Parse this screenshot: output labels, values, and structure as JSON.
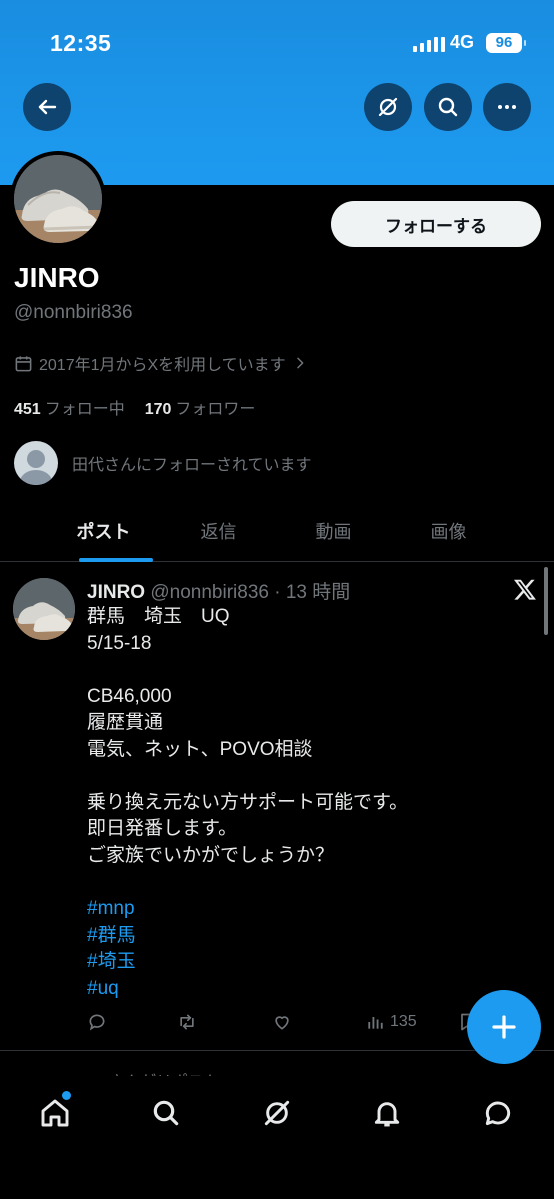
{
  "status_bar": {
    "time": "12:35",
    "network": "4G",
    "battery": "96"
  },
  "header": {
    "back_icon": "arrow-left-icon",
    "grok_icon": "grok-icon",
    "search_icon": "search-icon",
    "more_icon": "more-icon"
  },
  "profile": {
    "follow_label": "フォローする",
    "display_name": "JINRO",
    "handle": "@nonnbiri836",
    "joined": "2017年1月からXを利用しています",
    "following_count": "451",
    "following_label": "フォロー中",
    "followers_count": "170",
    "followers_label": "フォロワー",
    "followed_by": "田代さんにフォローされています"
  },
  "tabs": [
    {
      "label": "ポスト",
      "active": true
    },
    {
      "label": "返信",
      "active": false
    },
    {
      "label": "動画",
      "active": false
    },
    {
      "label": "画像",
      "active": false
    }
  ],
  "post": {
    "name": "JINRO",
    "meta": "@nonnbiri836 · 13 時間",
    "body": "群馬　埼玉　UQ\n5/15-18\n\nCB46,000\n履歴貫通\n電気、ネット、POVO相談\n\n乗り換え元ない方サポート可能です。\n即日発番します。\nご家族でいかがでしょうか？",
    "hashtags": [
      "#mnp",
      "#群馬",
      "#埼玉",
      "#uq"
    ],
    "views": "135"
  },
  "repost_peek": "JINROさんがリポスト",
  "colors": {
    "accent": "#1d9bf0",
    "background": "#000000",
    "muted": "#71767b"
  }
}
